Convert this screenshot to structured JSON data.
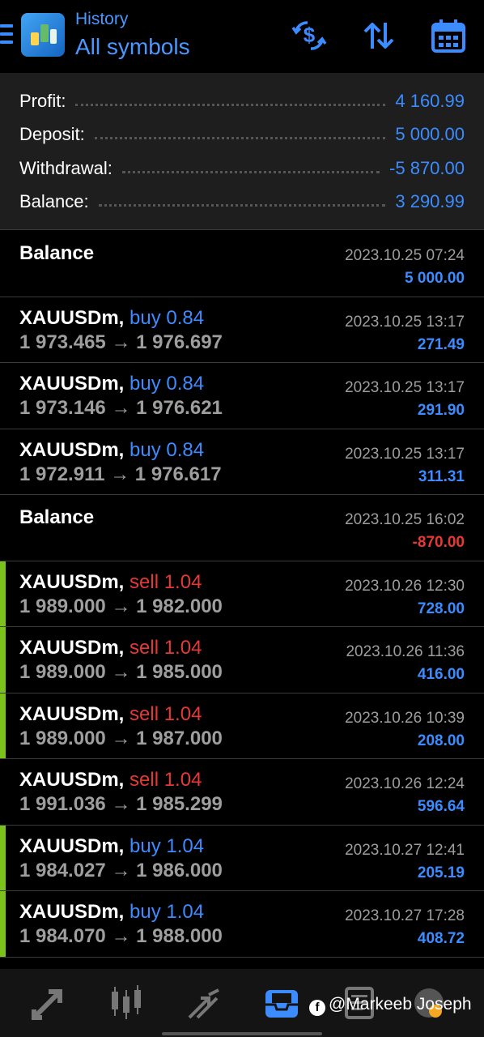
{
  "header": {
    "subtitle": "History",
    "title": "All symbols",
    "icons": [
      "menu-icon",
      "app-logo",
      "deposit-swap-icon",
      "sort-icon",
      "calendar-icon"
    ]
  },
  "summary": [
    {
      "label": "Profit:",
      "value": "4 160.99"
    },
    {
      "label": "Deposit:",
      "value": "5 000.00"
    },
    {
      "label": "Withdrawal:",
      "value": "-5 870.00"
    },
    {
      "label": "Balance:",
      "value": "3 290.99"
    }
  ],
  "rows": [
    {
      "type": "balance",
      "title": "Balance",
      "date": "2023.10.25 07:24",
      "profit": "5 000.00",
      "neg": false,
      "accent": false
    },
    {
      "type": "trade",
      "symbol": "XAUUSDm,",
      "side": "buy",
      "volume": "buy 0.84",
      "open": "1 973.465",
      "arrow": "→",
      "close": "1 976.697",
      "date": "2023.10.25 13:17",
      "profit": "271.49",
      "neg": false,
      "accent": false
    },
    {
      "type": "trade",
      "symbol": "XAUUSDm,",
      "side": "buy",
      "volume": "buy 0.84",
      "open": "1 973.146",
      "arrow": "→",
      "close": "1 976.621",
      "date": "2023.10.25 13:17",
      "profit": "291.90",
      "neg": false,
      "accent": false
    },
    {
      "type": "trade",
      "symbol": "XAUUSDm,",
      "side": "buy",
      "volume": "buy 0.84",
      "open": "1 972.911",
      "arrow": "→",
      "close": "1 976.617",
      "date": "2023.10.25 13:17",
      "profit": "311.31",
      "neg": false,
      "accent": false
    },
    {
      "type": "balance",
      "title": "Balance",
      "date": "2023.10.25 16:02",
      "profit": "-870.00",
      "neg": true,
      "accent": false
    },
    {
      "type": "trade",
      "symbol": "XAUUSDm,",
      "side": "sell",
      "volume": "sell 1.04",
      "open": "1 989.000",
      "arrow": "→",
      "close": "1 982.000",
      "date": "2023.10.26 12:30",
      "profit": "728.00",
      "neg": false,
      "accent": true
    },
    {
      "type": "trade",
      "symbol": "XAUUSDm,",
      "side": "sell",
      "volume": "sell 1.04",
      "open": "1 989.000",
      "arrow": "→",
      "close": "1 985.000",
      "date": "2023.10.26 11:36",
      "profit": "416.00",
      "neg": false,
      "accent": true
    },
    {
      "type": "trade",
      "symbol": "XAUUSDm,",
      "side": "sell",
      "volume": "sell 1.04",
      "open": "1 989.000",
      "arrow": "→",
      "close": "1 987.000",
      "date": "2023.10.26 10:39",
      "profit": "208.00",
      "neg": false,
      "accent": true
    },
    {
      "type": "trade",
      "symbol": "XAUUSDm,",
      "side": "sell",
      "volume": "sell 1.04",
      "open": "1 991.036",
      "arrow": "→",
      "close": "1 985.299",
      "date": "2023.10.26 12:24",
      "profit": "596.64",
      "neg": false,
      "accent": false
    },
    {
      "type": "trade",
      "symbol": "XAUUSDm,",
      "side": "buy",
      "volume": "buy 1.04",
      "open": "1 984.027",
      "arrow": "→",
      "close": "1 986.000",
      "date": "2023.10.27 12:41",
      "profit": "205.19",
      "neg": false,
      "accent": true
    },
    {
      "type": "trade",
      "symbol": "XAUUSDm,",
      "side": "buy",
      "volume": "buy 1.04",
      "open": "1 984.070",
      "arrow": "→",
      "close": "1 988.000",
      "date": "2023.10.27 17:28",
      "profit": "408.72",
      "neg": false,
      "accent": true
    }
  ],
  "bottom_nav": {
    "items": [
      "quotes-icon",
      "chart-icon",
      "trade-icon",
      "history-icon",
      "news-icon",
      "chat-icon"
    ],
    "active": "history-icon"
  },
  "watermark": {
    "text": "@Markeeb Joseph",
    "fb_glyph": "f"
  },
  "colors": {
    "accent_blue": "#3c8cff",
    "loss_red": "#e53935",
    "row_accent_green": "#7cc21c"
  }
}
